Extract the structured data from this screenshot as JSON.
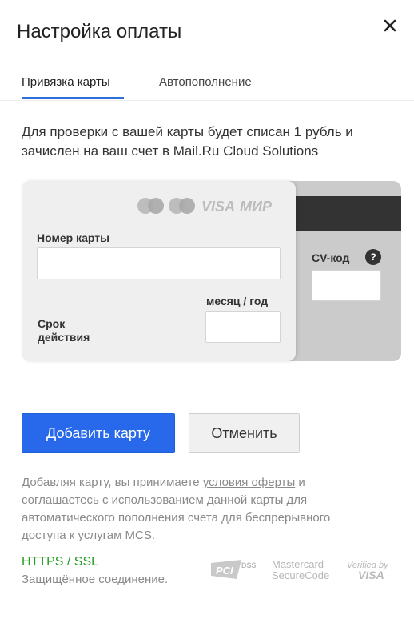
{
  "dialog": {
    "title": "Настройка оплаты",
    "close_icon": "close-icon"
  },
  "tabs": [
    {
      "label": "Привязка карты",
      "active": true
    },
    {
      "label": "Автопополнение",
      "active": false
    }
  ],
  "description": "Для проверки с вашей карты будет списан 1 рубль и зачислен на ваш счет в Mail.Ru Cloud Solutions",
  "card": {
    "brands": [
      "mastercard",
      "maestro",
      "VISA",
      "МИР"
    ],
    "number_label": "Номер карты",
    "number_value": "",
    "expiry_format_label": "месяц / год",
    "expiry_label_line1": "Срок",
    "expiry_label_line2": "действия",
    "expiry_value": "",
    "cvv_label": "CV-код",
    "cvv_help": "?",
    "cvv_value": ""
  },
  "buttons": {
    "add_card": "Добавить карту",
    "cancel": "Отменить"
  },
  "legal": {
    "prefix": "Добавляя карту, вы принимаете ",
    "link": "условия оферты",
    "suffix": " и соглашаетесь с использованием данной карты для автоматического пополнения счета для беспрерывного доступа к услугам MCS."
  },
  "security": {
    "protocol": "HTTPS / SSL",
    "caption": "Защищённое соединение.",
    "badges": [
      {
        "name": "pci-dss",
        "text": "PCI DSS"
      },
      {
        "name": "mastercard-securecode",
        "line1": "Mastercard",
        "line2": "SecureCode"
      },
      {
        "name": "verified-by-visa",
        "line1": "Verified by",
        "line2": "VISA"
      }
    ]
  },
  "colors": {
    "accent": "#2869ec",
    "tab_underline": "#2f6fd9",
    "secure_green": "#25a025",
    "muted_text": "#8a8a8a"
  }
}
